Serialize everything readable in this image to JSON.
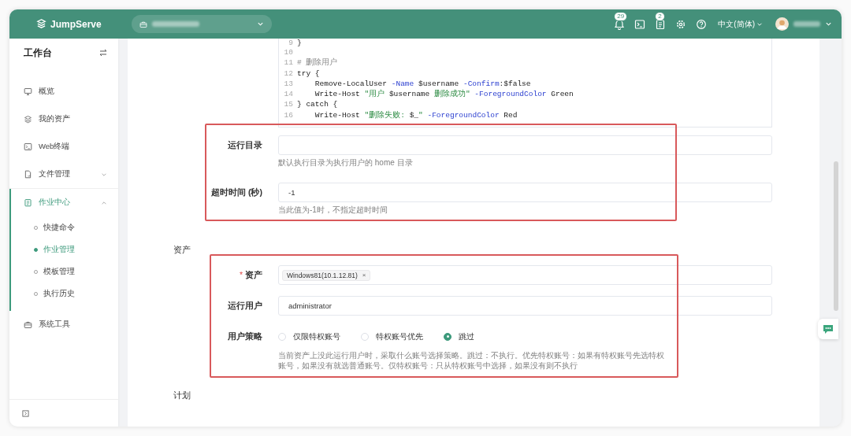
{
  "topbar": {
    "logo": "JumpServe",
    "actions": [
      {
        "kind": "bell",
        "badge": "29"
      },
      {
        "kind": "terminal"
      },
      {
        "kind": "clipboard",
        "badge": "2"
      },
      {
        "kind": "gear"
      },
      {
        "kind": "help"
      }
    ],
    "language": "中文(简体)"
  },
  "sidebar": {
    "title": "工作台",
    "items": [
      {
        "label": "概览",
        "selected": false
      },
      {
        "label": "我的资产",
        "selected": false
      },
      {
        "label": "Web终端",
        "selected": false
      },
      {
        "label": "文件管理",
        "selected": false,
        "expanded": false
      },
      {
        "label": "作业中心",
        "selected": true,
        "expanded": true,
        "children": [
          {
            "label": "快捷命令",
            "selected": false
          },
          {
            "label": "作业管理",
            "selected": true
          },
          {
            "label": "模板管理",
            "selected": false
          },
          {
            "label": "执行历史",
            "selected": false
          }
        ]
      },
      {
        "label": "系统工具",
        "selected": false
      }
    ]
  },
  "form": {
    "code_editor": {
      "lines": [
        {
          "number": "9",
          "tokens": [
            {
              "kind": "plain",
              "text": "}"
            }
          ]
        },
        {
          "number": "10"
        },
        {
          "number": "11",
          "tokens": [
            {
              "kind": "comment",
              "text": "# 删除用户"
            }
          ]
        },
        {
          "number": "12",
          "tokens": [
            {
              "kind": "plain",
              "text": "try {"
            }
          ]
        },
        {
          "number": "13",
          "tokens": [
            {
              "kind": "plain",
              "text": "    Remove-LocalUser "
            },
            {
              "kind": "param",
              "text": "-Name"
            },
            {
              "kind": "plain",
              "text": " $username "
            },
            {
              "kind": "param",
              "text": "-Confirm"
            },
            {
              "kind": "plain",
              "text": ":$false"
            }
          ]
        },
        {
          "number": "14",
          "tokens": [
            {
              "kind": "plain",
              "text": "    Write-Host "
            },
            {
              "kind": "string",
              "text": "\"用户 "
            },
            {
              "kind": "plain",
              "text": "$username"
            },
            {
              "kind": "string",
              "text": " 删除成功\""
            },
            {
              "kind": "param",
              "text": " -ForegroundColor"
            },
            {
              "kind": "plain",
              "text": " Green"
            }
          ]
        },
        {
          "number": "15",
          "tokens": [
            {
              "kind": "plain",
              "text": "} catch {"
            }
          ]
        },
        {
          "number": "16",
          "tokens": [
            {
              "kind": "plain",
              "text": "    Write-Host "
            },
            {
              "kind": "string",
              "text": "\"删除失败: "
            },
            {
              "kind": "plain",
              "text": "$_"
            },
            {
              "kind": "string",
              "text": "\""
            },
            {
              "kind": "param",
              "text": " -ForegroundColor"
            },
            {
              "kind": "plain",
              "text": " Red"
            }
          ]
        }
      ]
    },
    "groups": [
      {
        "highlighted": true,
        "fields": [
          {
            "kind": "text",
            "label": "运行目录",
            "hint": "默认执行目录为执行用户的 home 目录"
          },
          {
            "kind": "text",
            "label": "超时时间 (秒)",
            "value": "-1",
            "hint": "当此值为-1时，不指定超时时间"
          }
        ]
      }
    ],
    "sections": [
      {
        "title": "资产",
        "groups": [
          {
            "highlighted": true,
            "fields": [
              {
                "kind": "tags",
                "label": "资产",
                "required": true,
                "required_mark": "*",
                "tags": [
                  {
                    "label": "Windows81(10.1.12.81)",
                    "remove": "×"
                  }
                ]
              },
              {
                "kind": "text",
                "label": "运行用户",
                "value": "administrator"
              },
              {
                "kind": "radio",
                "label": "用户策略",
                "options": [
                  {
                    "label": "仅限特权账号",
                    "selected": false
                  },
                  {
                    "label": "特权账号优先",
                    "selected": false
                  },
                  {
                    "label": "跳过",
                    "selected": true
                  }
                ],
                "hint": "当前资产上没此运行用户时，采取什么账号选择策略。跳过：不执行。优先特权账号：如果有特权账号先选特权账号，如果没有就选普通账号。仅特权账号：只从特权账号中选择，如果没有则不执行"
              }
            ]
          }
        ]
      },
      {
        "title": "计划"
      }
    ]
  }
}
